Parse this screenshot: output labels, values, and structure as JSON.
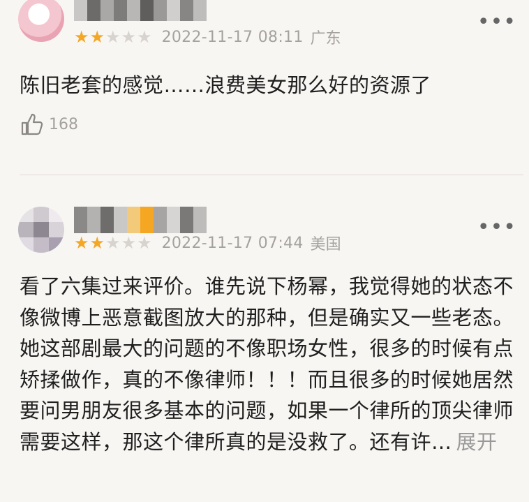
{
  "reviews": [
    {
      "rating": 2,
      "rating_max": 5,
      "date": "2022-11-17 08:11",
      "region": "广东",
      "text": "陈旧老套的感觉……浪费美女那么好的资源了",
      "likes": "168",
      "more_icon": "more-dots-icon"
    },
    {
      "rating": 2,
      "rating_max": 5,
      "date": "2022-11-17 07:44",
      "region": "美国",
      "text": "看了六集过来评价。谁先说下杨幂，我觉得她的状态不像微博上恶意截图放大的那种，但是确实又一些老态。她这部剧最大的问题的不像职场女性，很多的时候有点矫揉做作，真的不像律师！！！而且很多的时候她居然要问男朋友很多基本的问题，如果一个律所的顶尖律师需要这样，那这个律所真的是没救了。还有许…",
      "expand_label": "展开",
      "more_icon": "more-dots-icon"
    }
  ],
  "colors": {
    "star_on": "#f5a623",
    "star_off": "#d7d4d0",
    "meta_gray": "#a5a29e",
    "background": "#f8f6f3"
  }
}
